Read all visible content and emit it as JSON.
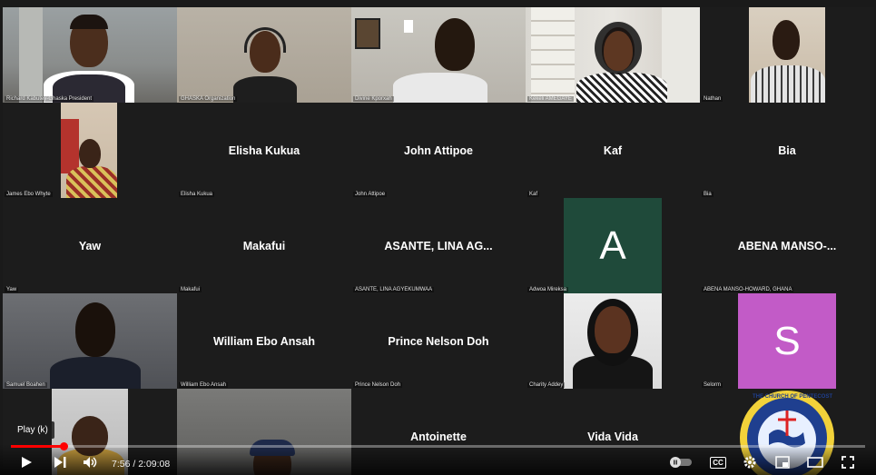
{
  "tiles": [
    {
      "label": "Richard Kabutey-Ghaska President",
      "name": ""
    },
    {
      "label": "GHASKA Organization",
      "name": ""
    },
    {
      "label": "Divine Kporxah",
      "name": ""
    },
    {
      "label": "Kekeli AMEGAYE",
      "name": ""
    },
    {
      "label": "Nathan",
      "name": ""
    },
    {
      "label": "James Ebo Whyte",
      "name": ""
    },
    {
      "label": "Elisha Kukua",
      "name": "Elisha Kukua"
    },
    {
      "label": "John Attipoe",
      "name": "John Attipoe"
    },
    {
      "label": "Kaf",
      "name": "Kaf"
    },
    {
      "label": "Bia",
      "name": "Bia"
    },
    {
      "label": "Yaw",
      "name": "Yaw"
    },
    {
      "label": "Makafui",
      "name": "Makafui"
    },
    {
      "label": "ASANTE, LINA AGYEKUMWAA",
      "name": "ASANTE, LINA AG..."
    },
    {
      "label": "Adwoa Mireksa",
      "name": "",
      "avatar_letter": "A"
    },
    {
      "label": "ABENA MANSO-HOWARD, GHANA",
      "name": "ABENA MANSO-..."
    },
    {
      "label": "Samuel Boahen",
      "name": ""
    },
    {
      "label": "William Ebo Ansah",
      "name": "William Ebo Ansah"
    },
    {
      "label": "Prince Nelson Doh",
      "name": "Prince Nelson Doh"
    },
    {
      "label": "Charity Addey",
      "name": ""
    },
    {
      "label": "Selorm",
      "name": "",
      "avatar_letter": "S"
    },
    {
      "label": "",
      "name": ""
    },
    {
      "label": "",
      "name": ""
    },
    {
      "label": "",
      "name": "Antoinette"
    },
    {
      "label": "",
      "name": "Vida Vida"
    },
    {
      "label": "",
      "name": "",
      "logo_text": "THE CHURCH OF PENTECOST"
    }
  ],
  "avatar_colors": {
    "A": "#1f4a3a",
    "S": "#c25bc7"
  },
  "player": {
    "tooltip": "Play (k)",
    "time_current": "7:56",
    "time_separator": " / ",
    "time_total": "2:09:08",
    "progress_fraction": 0.0614,
    "cc_label": "CC",
    "accent_color": "#ff0000"
  }
}
